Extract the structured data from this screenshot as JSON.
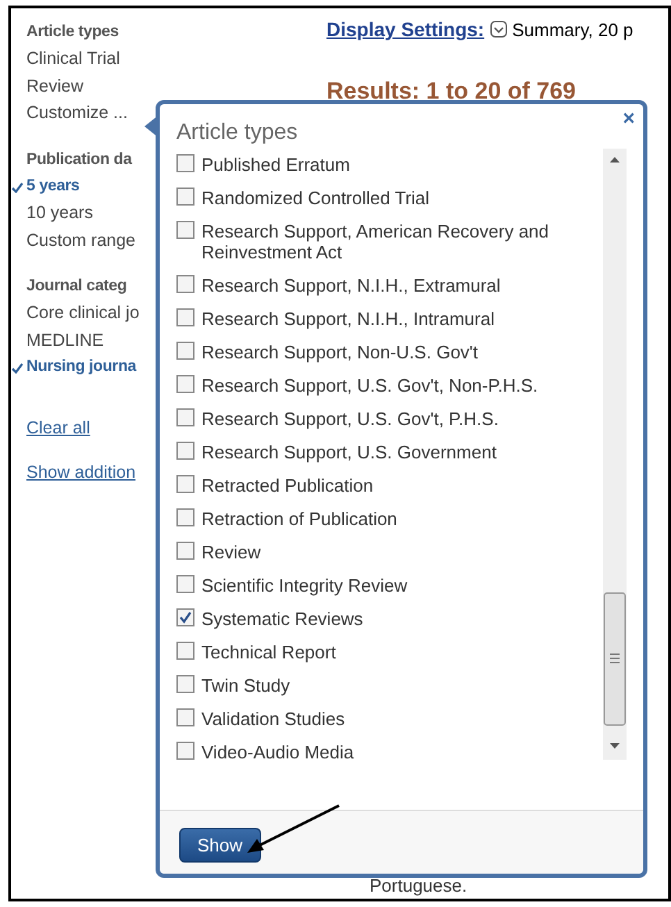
{
  "sidebar": {
    "groups": [
      {
        "title": "Article types",
        "items": [
          {
            "label": "Clinical Trial",
            "selected": false
          },
          {
            "label": "Review",
            "selected": false
          },
          {
            "label": "Customize ...",
            "selected": false
          }
        ]
      },
      {
        "title": "Publication da",
        "items": [
          {
            "label": "5 years",
            "selected": true
          },
          {
            "label": "10 years",
            "selected": false
          },
          {
            "label": "Custom range",
            "selected": false
          }
        ]
      },
      {
        "title": "Journal categ",
        "items": [
          {
            "label": "Core clinical jo",
            "selected": false
          },
          {
            "label": "MEDLINE",
            "selected": false
          },
          {
            "label": "Nursing journa",
            "selected": true
          }
        ]
      }
    ],
    "links": [
      "Clear all",
      "Show addition"
    ]
  },
  "main": {
    "display_settings": "Display Settings:",
    "summary": "Summary, 20 p",
    "results": "Results: 1 to 20 of 769",
    "footer_text": "Portuguese."
  },
  "popup": {
    "title": "Article types",
    "close": "×",
    "items": [
      {
        "label": "Published Erratum",
        "checked": false
      },
      {
        "label": "Randomized Controlled Trial",
        "checked": false
      },
      {
        "label": "Research Support, American Recovery and Reinvestment Act",
        "checked": false
      },
      {
        "label": "Research Support, N.I.H., Extramural",
        "checked": false
      },
      {
        "label": "Research Support, N.I.H., Intramural",
        "checked": false
      },
      {
        "label": "Research Support, Non-U.S. Gov't",
        "checked": false
      },
      {
        "label": "Research Support, U.S. Gov't, Non-P.H.S.",
        "checked": false
      },
      {
        "label": "Research Support, U.S. Gov't, P.H.S.",
        "checked": false
      },
      {
        "label": "Research Support, U.S. Government",
        "checked": false
      },
      {
        "label": "Retracted Publication",
        "checked": false
      },
      {
        "label": "Retraction of Publication",
        "checked": false
      },
      {
        "label": "Review",
        "checked": false
      },
      {
        "label": "Scientific Integrity Review",
        "checked": false
      },
      {
        "label": "Systematic Reviews",
        "checked": true
      },
      {
        "label": "Technical Report",
        "checked": false
      },
      {
        "label": "Twin Study",
        "checked": false
      },
      {
        "label": "Validation Studies",
        "checked": false
      },
      {
        "label": "Video-Audio Media",
        "checked": false
      }
    ],
    "button": "Show"
  }
}
